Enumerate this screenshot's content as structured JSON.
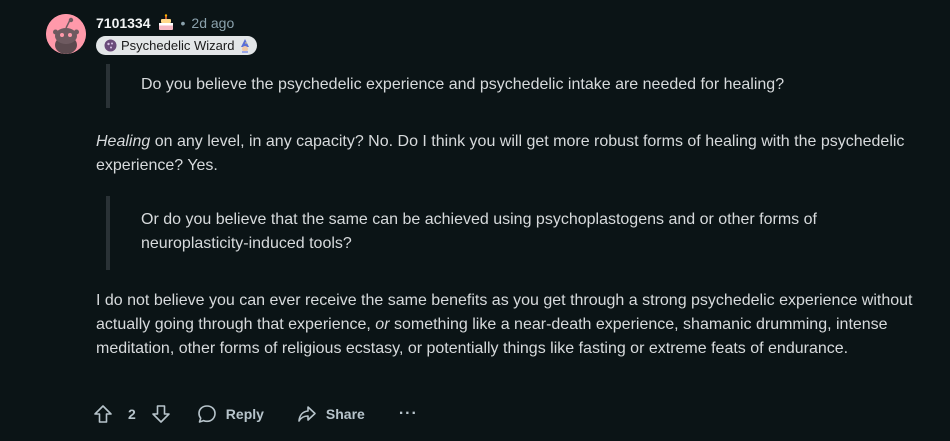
{
  "comment": {
    "username": "7101334",
    "cake_day_icon": "cake-icon",
    "separator": "•",
    "timestamp": "2d ago",
    "flair": {
      "icon": "mushroom-icon",
      "label": "Psychedelic Wizard",
      "emoji_icon": "wizard-icon"
    },
    "quote1": "Do you believe the psychedelic experience and psychedelic intake are needed for healing?",
    "paragraph1": {
      "emphasis": "Healing",
      "rest": " on any level, in any capacity? No. Do I think you will get more robust forms of healing with the psychedelic experience? Yes."
    },
    "quote2": "Or do you believe that the same can be achieved using psychoplastogens and or other forms of neuroplasticity-induced tools?",
    "paragraph2": {
      "before": "I do not believe you can ever receive the same benefits as you get through a strong psychedelic experience without actually going through that experience, ",
      "emphasis": "or",
      "after": " something like a near-death experience, shamanic drumming, intense meditation, other forms of religious ecstasy, or potentially things like fasting or extreme feats of endurance."
    },
    "actions": {
      "vote_count": "2",
      "reply_label": "Reply",
      "share_label": "Share",
      "more_label": "···"
    }
  },
  "colors": {
    "background": "#0b1416",
    "text": "#d7dadc",
    "avatar": "#ff99aa",
    "flair_bg": "#e3e6e8",
    "quote_border": "#2a3236"
  }
}
